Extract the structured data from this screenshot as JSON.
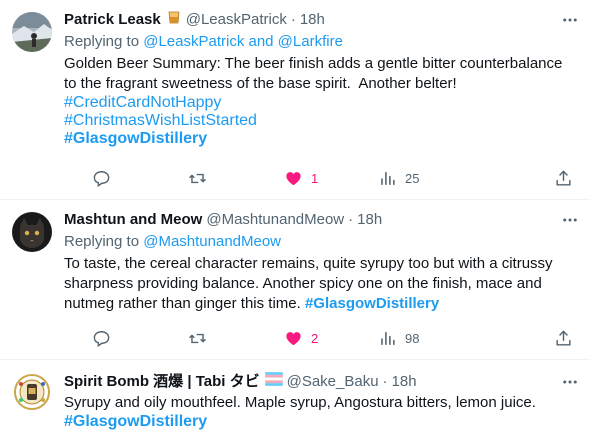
{
  "colors": {
    "accent": "#1d9bf0",
    "like": "#f91880",
    "muted": "#536471",
    "text": "#0f1419"
  },
  "tweets": [
    {
      "name": "Patrick Leask",
      "emoji": "🥃",
      "handle": "@LeaskPatrick",
      "sep": "·",
      "time": "18h",
      "reply_prefix": "Replying to ",
      "reply_to": "@LeaskPatrick and @Larkfire",
      "body": "Golden Beer Summary: The beer finish adds a gentle bitter counterbalance to the fragrant sweetness of the base spirit.  Another belter!",
      "tags": [
        "#CreditCardNotHappy",
        "#ChristmasWishListStarted",
        "#GlasgowDistillery"
      ],
      "actions": {
        "reply": "",
        "retweet": "",
        "likes": "1",
        "views": "25"
      },
      "liked": true,
      "icons": [
        "reply-icon",
        "retweet-icon",
        "heart-icon",
        "views-icon",
        "share-icon",
        "more-icon"
      ]
    },
    {
      "name": "Mashtun and Meow",
      "handle": "@MashtunandMeow",
      "sep": "·",
      "time": "18h",
      "reply_prefix": "Replying to ",
      "reply_to": "@MashtunandMeow",
      "body": "To taste, the cereal character remains, quite syrupy too but with a citrussy sharpness providing balance. Another spicy one on the finish, mace and nutmeg rather than ginger this time. ",
      "inline_tag": "#GlasgowDistillery",
      "actions": {
        "reply": "",
        "retweet": "",
        "likes": "2",
        "views": "98"
      },
      "liked": true
    },
    {
      "name": "Spirit Bomb 酒爆 | Tabi タビ",
      "handle": "@Sake_Baku",
      "sep": "·",
      "time": "18h",
      "body": "Syrupy and oily mouthfeel. Maple syrup, Angostura bitters, lemon juice.",
      "tags": [
        "#GlasgowDistillery"
      ]
    }
  ]
}
